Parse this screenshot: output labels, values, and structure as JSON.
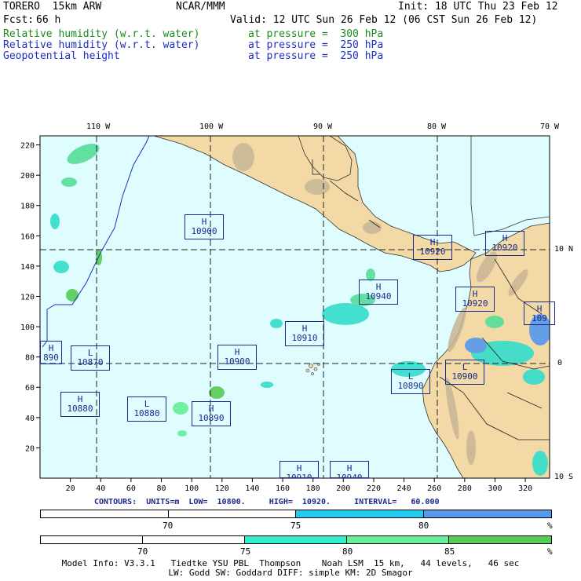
{
  "header": {
    "model": "TORERO  15km ARW",
    "center": "NCAR/MMM",
    "init": "Init: 18 UTC Thu 23 Feb 12",
    "fcst_label": "Fcst:",
    "fcst_value": "66 h",
    "valid": "Valid: 12 UTC Sun 26 Feb 12 (06 CST Sun 26 Feb 12)",
    "fields": [
      {
        "name": "Relative humidity (w.r.t. water)",
        "level": "at pressure =  300 hPa",
        "color": "#1a8a1a"
      },
      {
        "name": "Relative humidity (w.r.t. water)",
        "level": "at pressure =  250 hPa",
        "color": "#1e2fc0"
      },
      {
        "name": "Geopotential height",
        "level": "at pressure =  250 hPa",
        "color": "#1e2fc0"
      }
    ]
  },
  "map": {
    "lon_labels": [
      "110 W",
      "100 W",
      "90 W",
      "80 W",
      "70 W"
    ],
    "lat_labels": [
      "10 N",
      "0",
      "10 S"
    ],
    "x_ticks": [
      "20",
      "40",
      "60",
      "80",
      "100",
      "120",
      "140",
      "160",
      "180",
      "200",
      "220",
      "240",
      "260",
      "280",
      "300",
      "320"
    ],
    "y_ticks": [
      "220",
      "200",
      "180",
      "160",
      "140",
      "120",
      "100",
      "80",
      "60",
      "40",
      "20"
    ],
    "ocean_color": "#dffdff",
    "land_color": "#f2d9a6",
    "centers": [
      {
        "type": "H",
        "value": "10900"
      },
      {
        "type": "H",
        "value": "10920"
      },
      {
        "type": "H",
        "value": "10920"
      },
      {
        "type": "H",
        "value": "10940"
      },
      {
        "type": "H",
        "value": "10920"
      },
      {
        "type": "H",
        "value": "109"
      },
      {
        "type": "H",
        "value": "10910"
      },
      {
        "type": "H",
        "value": "890"
      },
      {
        "type": "L",
        "value": "10870"
      },
      {
        "type": "H",
        "value": "10900"
      },
      {
        "type": "L",
        "value": "10890"
      },
      {
        "type": "L",
        "value": "10900"
      },
      {
        "type": "H",
        "value": "10880"
      },
      {
        "type": "L",
        "value": "10880"
      },
      {
        "type": "H",
        "value": "10890"
      },
      {
        "type": "H",
        "value": "10910"
      },
      {
        "type": "H",
        "value": "10940"
      }
    ]
  },
  "contours": "CONTOURS:  UNITS=m  LOW=  10800.     HIGH=  10920.     INTERVAL=   60.000",
  "legend_top": {
    "labels": [
      "70",
      "75",
      "80",
      "%"
    ],
    "colors": [
      "#ffffff",
      "#ffffff",
      "#22ccee",
      "#5599ee"
    ]
  },
  "legend_bottom": {
    "labels": [
      "70",
      "75",
      "80",
      "85",
      "%"
    ],
    "colors": [
      "#ffffff",
      "#ffffff",
      "#33eecc",
      "#66ee99",
      "#55cc55"
    ]
  },
  "footer": {
    "line1": "Model Info: V3.3.1   Tiedtke YSU PBL  Thompson    Noah LSM  15 km,   44 levels,   46 sec",
    "line2": "LW: Godd SW: Goddard DIFF: simple KM: 2D Smagor"
  }
}
